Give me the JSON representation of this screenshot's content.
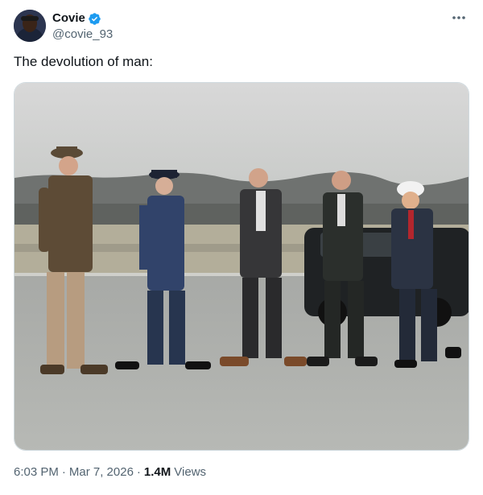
{
  "author": {
    "display_name": "Covie",
    "handle": "@covie_93",
    "verified_icon": "verified-badge-icon",
    "avatar_icon": "avatar"
  },
  "tweet": {
    "text": "The devolution of man:"
  },
  "media": {
    "alt_icon": "photo-image",
    "description_icon": "people-walking-photo"
  },
  "meta": {
    "time": "6:03 PM",
    "date": "Mar 7, 2026",
    "separator": "·",
    "views_count": "1.4M",
    "views_label": "Views"
  },
  "colors": {
    "text": "#0f1419",
    "secondary": "#536471",
    "verified": "#1d9bf0",
    "border": "#cfd9de"
  }
}
